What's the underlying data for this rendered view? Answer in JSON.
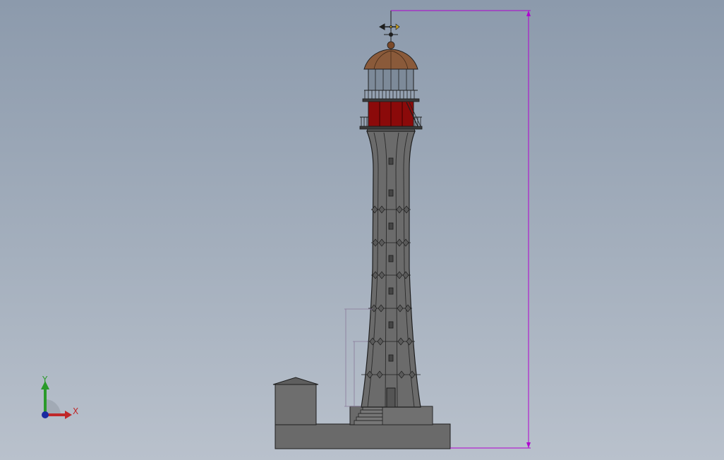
{
  "viewport": {
    "background_top": "#8c9aac",
    "background_bottom": "#b9c1cc"
  },
  "model": {
    "colors": {
      "tower_gray": "#6c6c6c",
      "lantern_red": "#8b0a0a",
      "dome_copper": "#8a5a3a",
      "outline": "#1e1e1e",
      "base_gray": "#6a6a6a"
    }
  },
  "dimensions": {
    "color": "#b000d0",
    "overall_height_text": "",
    "door_height_text": "",
    "window_height_text": ""
  },
  "triad": {
    "x_label": "X",
    "y_label": "Y",
    "x_color": "#c0282a",
    "y_color": "#2a9a2a",
    "origin_color": "#1a2aa0"
  },
  "icons": [
    "weather-vane-icon",
    "triad-icon"
  ]
}
